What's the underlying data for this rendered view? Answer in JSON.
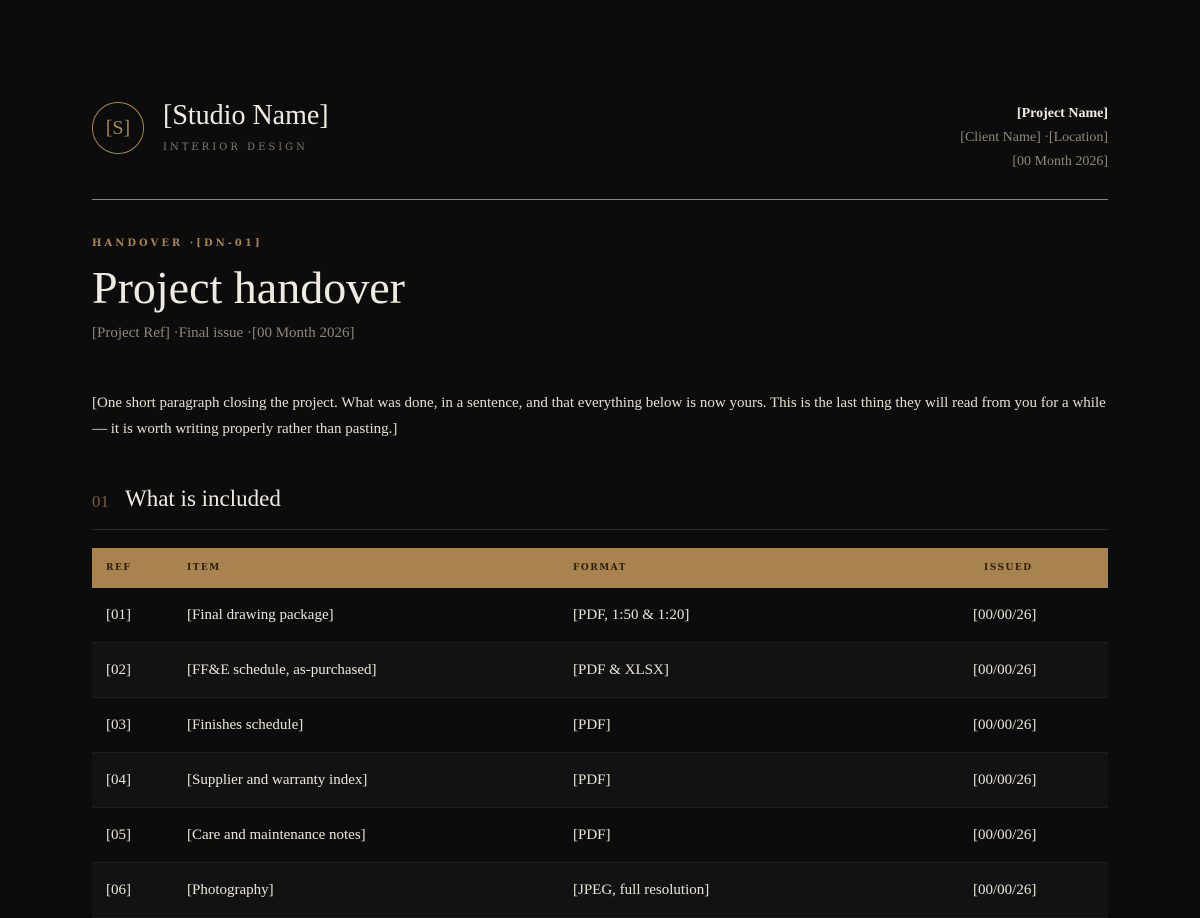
{
  "header": {
    "monogram": "[S]",
    "studio_name": "[Studio Name]",
    "studio_subtitle": "INTERIOR DESIGN",
    "project_name": "[Project Name]",
    "client_location": "[Client Name] ·[Location]",
    "date": "[00 Month 2026]"
  },
  "doc": {
    "eyebrow": "HANDOVER ·[DN-01]",
    "title": "Project handover",
    "subtitle": "[Project Ref] ·Final issue ·[00 Month 2026]",
    "intro": "[One short paragraph closing the project. What was done, in a sentence, and that everything below is now yours. This is the last thing they will read from you for a while — it is worth writing properly rather than pasting.]"
  },
  "section": {
    "number": "01",
    "title": "What is included"
  },
  "table": {
    "headers": [
      "REF",
      "ITEM",
      "FORMAT",
      "ISSUED"
    ],
    "rows": [
      [
        "[01]",
        "[Final drawing package]",
        "[PDF, 1:50 & 1:20]",
        "[00/00/26]"
      ],
      [
        "[02]",
        "[FF&E schedule, as-purchased]",
        "[PDF & XLSX]",
        "[00/00/26]"
      ],
      [
        "[03]",
        "[Finishes schedule]",
        "[PDF]",
        "[00/00/26]"
      ],
      [
        "[04]",
        "[Supplier and warranty index]",
        "[PDF]",
        "[00/00/26]"
      ],
      [
        "[05]",
        "[Care and maintenance notes]",
        "[PDF]",
        "[00/00/26]"
      ],
      [
        "[06]",
        "[Photography]",
        "[JPEG, full resolution]",
        "[00/00/26]"
      ]
    ]
  },
  "colors": {
    "background": "#0c0c0c",
    "accent_gold": "#a8834f",
    "text": "#e9e4d8",
    "muted": "#8d877a"
  }
}
